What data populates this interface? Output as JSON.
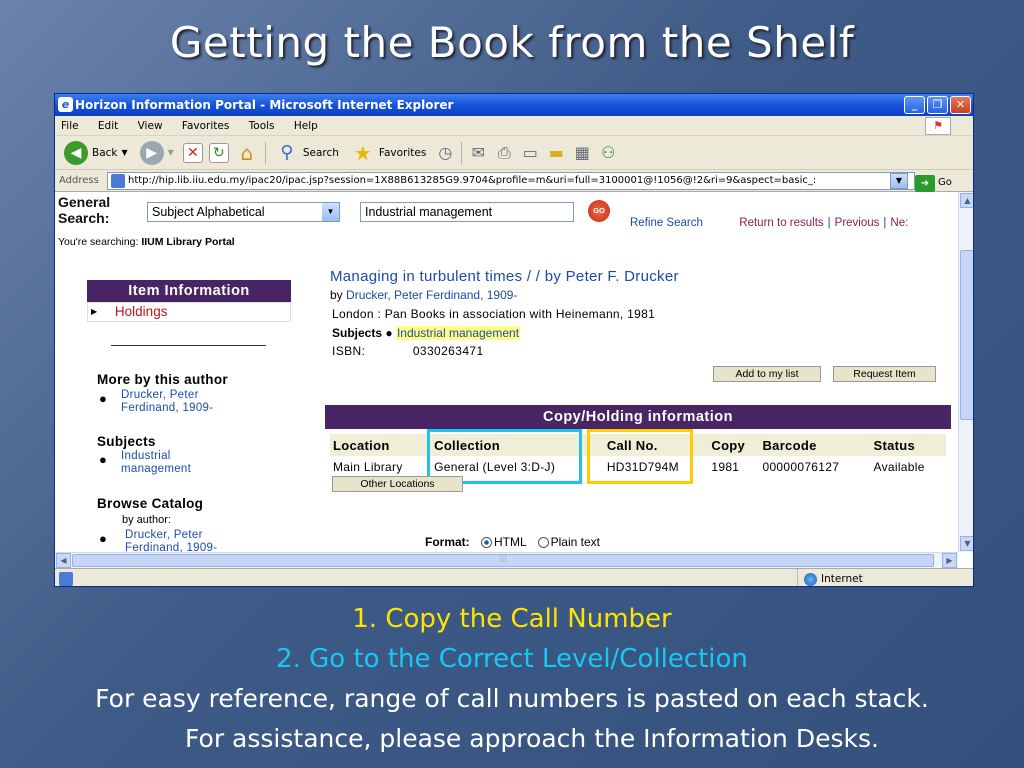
{
  "slide": {
    "title": "Getting the Book from the Shelf",
    "step1": "1. Copy the Call Number",
    "step2": "2. Go to the Correct Level/Collection",
    "note1": "For easy reference, range of call numbers is pasted on each stack.",
    "note2": "For assistance, please approach the Information Desks.",
    "colors": {
      "step1": "#ffe400",
      "step2": "#18c8f4",
      "highlight_collection": "#22c2e8",
      "highlight_callno": "#ffcc00"
    }
  },
  "browser": {
    "window_title": "Horizon Information Portal - Microsoft Internet Explorer",
    "menu": [
      "File",
      "Edit",
      "View",
      "Favorites",
      "Tools",
      "Help"
    ],
    "toolbar": {
      "back": "Back",
      "search": "Search",
      "favorites": "Favorites"
    },
    "address_label": "Address",
    "url": "http://hip.lib.iiu.edu.my/ipac20/ipac.jsp?session=1X88B613285G9.9704&profile=m&uri=full=3100001@!1056@!2&ri=9&aspect=basic_:",
    "go_label": "Go",
    "status_zone": "Internet"
  },
  "search": {
    "label_line1": "General",
    "label_line2": "Search:",
    "type_selected": "Subject Alphabetical",
    "query": "Industrial management",
    "go_label": "GO",
    "refine": "Refine Search",
    "return": "Return to results",
    "previous": "Previous",
    "next": "Ne:",
    "searching_prefix": "You're searching:",
    "searching_target": "IIUM Library Portal"
  },
  "sidebar": {
    "header": "Item Information",
    "holdings": "Holdings",
    "more_by_author": "More by this author",
    "author_link_1": "Drucker, Peter",
    "author_link_2": "Ferdinand, 1909-",
    "subjects_heading": "Subjects",
    "subject_link_1": "Industrial",
    "subject_link_2": "management",
    "browse_heading": "Browse Catalog",
    "by_author": "by author:",
    "browse_link_1": "Drucker, Peter",
    "browse_link_2": "Ferdinand, 1909-"
  },
  "record": {
    "title": "Managing in turbulent times / / by Peter F. Drucker",
    "by_prefix": "by",
    "author": "Drucker, Peter Ferdinand, 1909-",
    "publication": "London : Pan Books in association with Heinemann, 1981",
    "subjects_label": "Subjects",
    "subject": "Industrial management",
    "isbn_label": "ISBN:",
    "isbn": "0330263471",
    "add_to_list": "Add to my list",
    "request_item": "Request Item"
  },
  "holdings": {
    "header": "Copy/Holding information",
    "columns": [
      "Location",
      "Collection",
      "Call No.",
      "Copy",
      "Barcode",
      "Status"
    ],
    "rows": [
      [
        "Main Library",
        "General (Level 3:D-J)",
        "HD31D794M",
        "1981",
        "00000076127",
        "Available"
      ]
    ],
    "other_locations": "Other Locations",
    "format_label": "Format:",
    "format_html": "HTML",
    "format_plain": "Plain text"
  }
}
